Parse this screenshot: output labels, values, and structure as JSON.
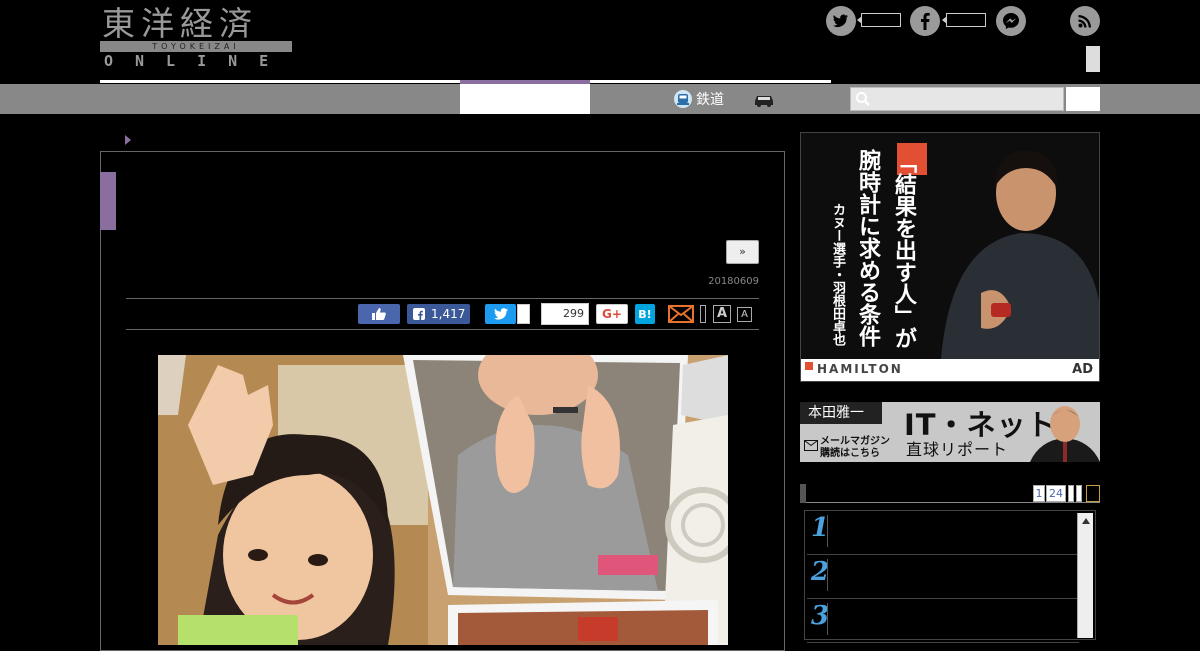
{
  "header": {
    "logo_kanji": "東洋経済",
    "logo_romaji": "TOYOKEIZAI",
    "logo_online": "ONLINE",
    "social_icons": [
      "twitter-icon",
      "facebook-icon",
      "messenger-icon",
      "rss-icon"
    ]
  },
  "nav": {
    "railway_label": "鉄道",
    "search_placeholder": ""
  },
  "article": {
    "next_label": "»",
    "date": "20180609",
    "share": {
      "facebook_count": "1,417",
      "hatena_count": "299",
      "gplus_label": "G+",
      "hatena_label": "B!",
      "font_large": "A",
      "font_small": "A"
    }
  },
  "ad": {
    "headline_1": "「結果を出す人」が",
    "headline_2": "腕時計に求める条件",
    "subline": "カヌー選手・羽根田卓也",
    "brand": "HAMILTON",
    "label": "AD"
  },
  "banner": {
    "author": "本田雅一",
    "title": "IT・ネット",
    "subtitle": "直球リポート",
    "magazine_line1": "メールマガジン",
    "magazine_line2": "購読はこちら"
  },
  "ranking": {
    "tabs": [
      "1",
      "24"
    ],
    "items": [
      {
        "rank": "1"
      },
      {
        "rank": "2"
      },
      {
        "rank": "3"
      }
    ]
  },
  "colors": {
    "accent_purple": "#8a6ea0",
    "nav_gray": "#888888",
    "facebook_blue": "#3b5998",
    "twitter_blue": "#1d9bf0",
    "hatena_blue": "#00a4de",
    "ranking_blue": "#4aa3df"
  }
}
